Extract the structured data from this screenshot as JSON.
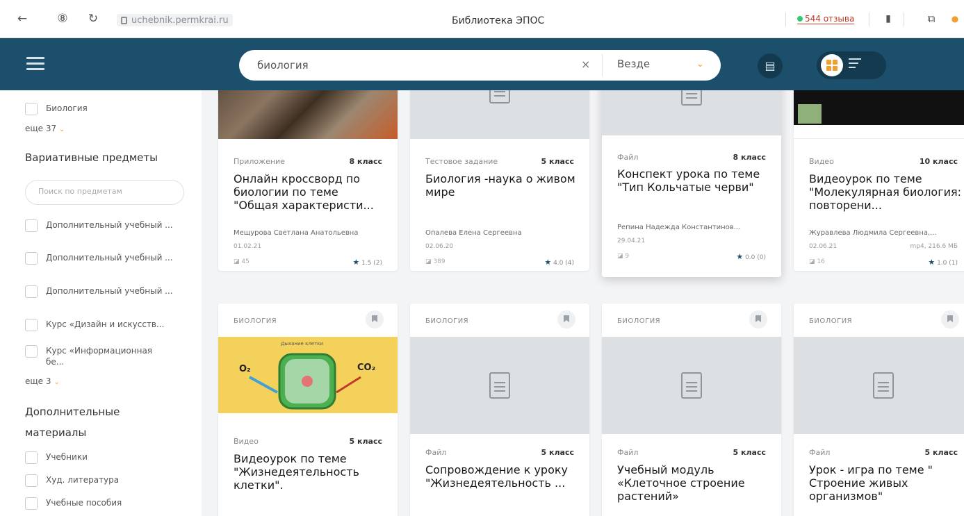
{
  "browser": {
    "url": "uchebnik.permkrai.ru",
    "title": "Библиотека ЭПОС",
    "reviews": "544 отзыва"
  },
  "header": {
    "search_value": "биология",
    "scope": "Везде"
  },
  "sidebar": {
    "top_item": "Биология",
    "more_1": "еще 37",
    "section_variative": "Вариативные предметы",
    "subject_search_placeholder": "Поиск по предметам",
    "variative_items": [
      "Дополнительный учебный ...",
      "Дополнительный учебный ...",
      "Дополнительный учебный ...",
      "Курс «Дизайн и искусств...",
      "Курс «Информационная бе..."
    ],
    "more_2": "еще 3",
    "section_additional": "Дополнительные материалы",
    "additional_items": [
      "Учебники",
      "Худ. литература",
      "Учебные пособия"
    ]
  },
  "cards_row1": [
    {
      "type": "Приложение",
      "grade": "8 класс",
      "title": "Онлайн кроссворд по биологии по теме \"Общая характеристи...",
      "author": "Мещурова Светлана Анатольевна",
      "date": "01.02.21",
      "meta": "",
      "views": "45",
      "rating": "1.5 (2)"
    },
    {
      "type": "Тестовое задание",
      "grade": "5 класс",
      "title": "Биология -наука о живом мире",
      "author": "Опалева Елена Сергеевна",
      "date": "02.06.20",
      "meta": "",
      "views": "389",
      "rating": "4.0 (4)"
    },
    {
      "type": "Файл",
      "grade": "8 класс",
      "title": "Конспект урока по теме \"Тип Кольчатые черви\"",
      "author": "Репина Надежда Константинов...",
      "date": "29.04.21",
      "meta": "",
      "views": "9",
      "rating": "0.0 (0)"
    },
    {
      "type": "Видео",
      "grade": "10 класс",
      "title": "Видеоурок по теме \"Молекулярная биология: повторени...",
      "author": "Журавлева Людмила Сергеевна,...",
      "date": "02.06.21",
      "meta": "mp4, 216.6 МБ",
      "views": "16",
      "rating": "1.0 (1)"
    }
  ],
  "cards_row2": [
    {
      "subject": "БИОЛОГИЯ",
      "type": "Видео",
      "grade": "5 класс",
      "title": "Видеоурок по теме \"Жизнедеятельность клетки\"."
    },
    {
      "subject": "БИОЛОГИЯ",
      "type": "Файл",
      "grade": "5 класс",
      "title": "Сопровождение к уроку \"Жизнедеятельность ..."
    },
    {
      "subject": "БИОЛОГИЯ",
      "type": "Файл",
      "grade": "5 класс",
      "title": "Учебный модуль «Клеточное строение растений»"
    },
    {
      "subject": "БИОЛОГИЯ",
      "type": "Файл",
      "grade": "5 класс",
      "title": "Урок - игра по теме \" Строение живых организмов\""
    }
  ],
  "cell_illustration": {
    "title": "Дыхание клетки",
    "o2": "O₂",
    "co2": "CO₂"
  },
  "colors": {
    "header": "#1c4f6b",
    "accent": "#f0a030"
  }
}
